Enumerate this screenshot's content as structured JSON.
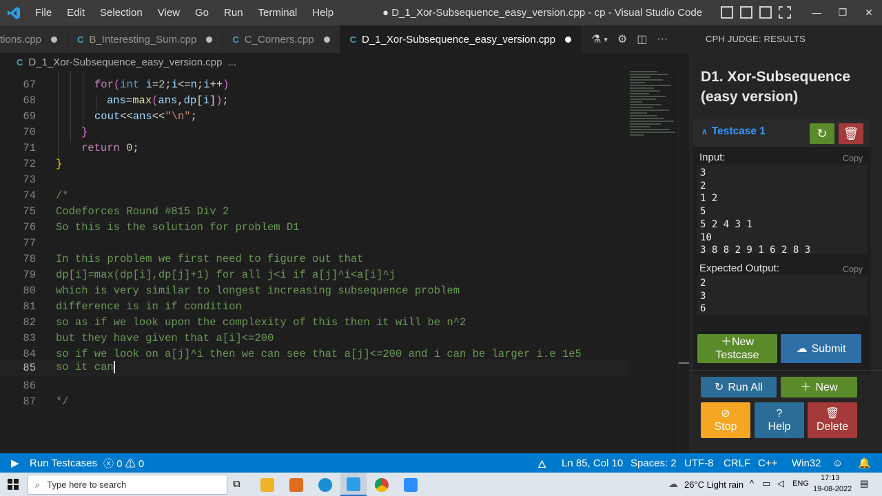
{
  "titlebar": {
    "logo_icon": "vscode-logo-icon",
    "menu": [
      "File",
      "Edit",
      "Selection",
      "View",
      "Go",
      "Run",
      "Terminal",
      "Help"
    ],
    "window_title": "● D_1_Xor-Subsequence_easy_version.cpp - cp - Visual Studio Code",
    "controls": [
      "—",
      "❐",
      "✕"
    ]
  },
  "tabs": [
    {
      "label": "tions.cpp",
      "active": false
    },
    {
      "label": "B_Interesting_Sum.cpp",
      "active": false
    },
    {
      "label": "C_Corners.cpp",
      "active": false
    },
    {
      "label": "D_1_Xor-Subsequence_easy_version.cpp",
      "active": true
    }
  ],
  "breadcrumb": {
    "file": "D_1_Xor-Subsequence_easy_version.cpp",
    "rest": "..."
  },
  "editor": {
    "lines": [
      {
        "n": "67",
        "text": "for(int i=2;i<=n;i++)"
      },
      {
        "n": "68",
        "text": "ans=max(ans,dp[i]);"
      },
      {
        "n": "69",
        "text": "cout<<ans<<\"\\n\";"
      },
      {
        "n": "70",
        "text": "}"
      },
      {
        "n": "71",
        "text": "return 0;"
      },
      {
        "n": "72",
        "text": "}"
      },
      {
        "n": "73",
        "text": ""
      },
      {
        "n": "74",
        "text": "/*"
      },
      {
        "n": "75",
        "text": "Codeforces Round #815 Div 2"
      },
      {
        "n": "76",
        "text": "So this is the solution for problem D1"
      },
      {
        "n": "77",
        "text": ""
      },
      {
        "n": "78",
        "text": "In this problem we first need to figure out that"
      },
      {
        "n": "79",
        "text": "dp[i]=max(dp[i],dp[j]+1) for all j<i if a[j]^i<a[i]^j"
      },
      {
        "n": "80",
        "text": "which is very similar to longest increasing subsequence problem"
      },
      {
        "n": "81",
        "text": "difference is in if condition"
      },
      {
        "n": "82",
        "text": "so as if we look upon the complexity of this then it will be n^2"
      },
      {
        "n": "83",
        "text": "but they have given that a[i]<=200"
      },
      {
        "n": "84",
        "text": "so if we look on a[j]^i then we can see that a[j]<=200 and i can be larger i.e 1e5"
      },
      {
        "n": "85",
        "text": "so it can"
      },
      {
        "n": "86",
        "text": ""
      },
      {
        "n": "87",
        "text": "*/"
      }
    ]
  },
  "cph": {
    "header": "CPH JUDGE: RESULTS",
    "problem_title": "D1. Xor-Subsequence (easy version)",
    "testcase_label": "Testcase 1",
    "input_label": "Input:",
    "input_value": "3\n2\n1 2\n5\n5 2 4 3 1\n10\n3 8 8 2 9 1 6 2 8 3",
    "expected_label": "Expected Output:",
    "expected_value": "2\n3\n6",
    "copy_label": "Copy",
    "buttons": {
      "new_testcase": "New\nTestcase",
      "submit": "Submit",
      "run_all": "Run All",
      "new": "New",
      "stop": "Stop",
      "help": "Help",
      "delete": "Delete"
    },
    "colors": {
      "green": "#5b8a2b",
      "blue": "#2e6fa8",
      "red": "#a53a3a",
      "orange": "#f5a623",
      "cyan": "#2b6d96"
    }
  },
  "statusbar": {
    "run_testcases": "Run Testcases",
    "errors": "0",
    "warnings": "0",
    "position": "Ln 85, Col 10",
    "spaces": "Spaces: 2",
    "encoding": "UTF-8",
    "eol": "CRLF",
    "language": "C++",
    "platform": "Win32"
  },
  "taskbar": {
    "search_placeholder": "Type here to search",
    "weather": "26°C  Light rain",
    "lang": "ENG",
    "time": "17:13",
    "date": "19-08-2022"
  }
}
